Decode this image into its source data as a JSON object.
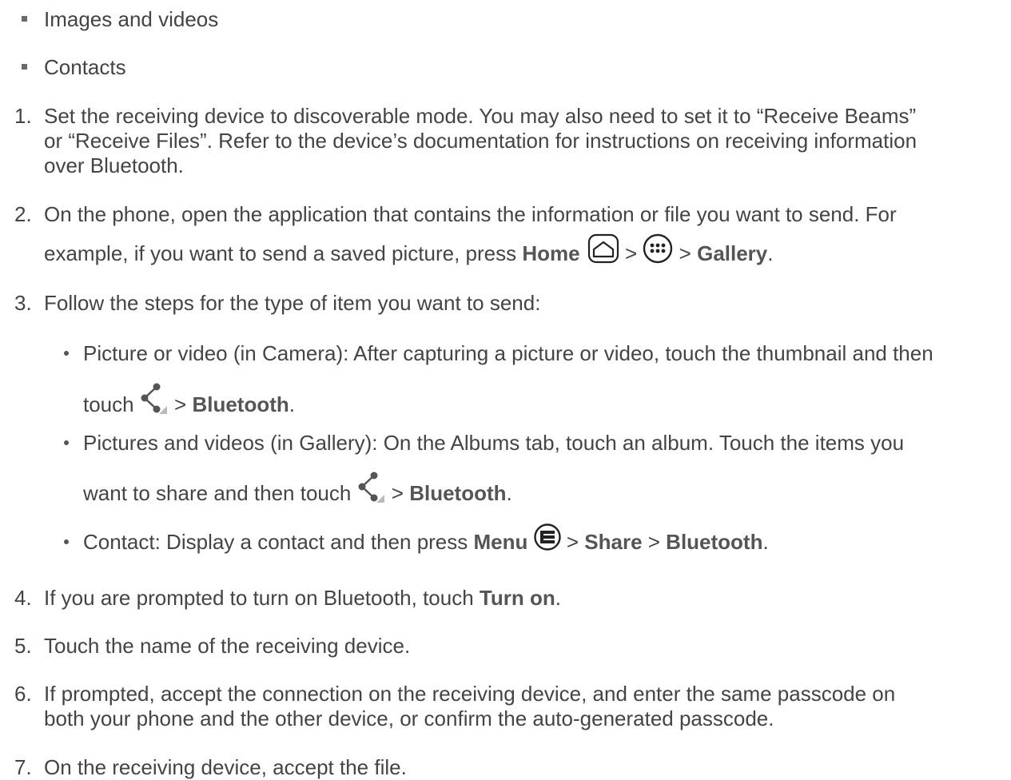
{
  "bullets": [
    "Images and videos",
    "Contacts"
  ],
  "steps": {
    "s1": {
      "num": "1.",
      "lines": [
        "Set the receiving device to discoverable mode. You may also need to set it to “Receive Beams”",
        "or “Receive Files”. Refer to the device’s documentation for instructions on receiving information",
        "over Bluetooth."
      ]
    },
    "s2": {
      "num": "2.",
      "line1": "On the phone, open the application that contains the information or file you want to send. For",
      "line2_pre": "example, if you want to send a saved picture, press ",
      "home": "Home",
      "sep": " > ",
      "gallery": "Gallery",
      "end": "."
    },
    "s3": {
      "num": "3.",
      "text": "Follow the steps for the type of item you want to send:",
      "sub1": {
        "line1": "Picture or video (in Camera): After capturing a picture or video, touch the thumbnail and then",
        "line2_pre": "touch ",
        "sep": " > ",
        "bluetooth": "Bluetooth",
        "end": "."
      },
      "sub2": {
        "line1": "Pictures and videos (in Gallery): On the Albums tab, touch an album. Touch the items you",
        "line2_pre": "want to share and then touch ",
        "sep": " > ",
        "bluetooth": "Bluetooth",
        "end": "."
      },
      "sub3": {
        "pre": "Contact: Display a contact and then press ",
        "menu": "Menu",
        "sep1": " > ",
        "share": "Share",
        "sep2": " > ",
        "bluetooth": "Bluetooth",
        "end": "."
      }
    },
    "s4": {
      "num": "4.",
      "pre": "If you are prompted to turn on Bluetooth, touch ",
      "turn_on": "Turn on",
      "end": "."
    },
    "s5": {
      "num": "5.",
      "text": "Touch the name of the receiving device."
    },
    "s6": {
      "num": "6.",
      "lines": [
        "If prompted, accept the connection on the receiving device, and enter the same passcode on",
        "both your phone and the other device, or confirm the auto-generated passcode."
      ]
    },
    "s7": {
      "num": "7.",
      "text": "On the receiving device, accept the file."
    }
  }
}
